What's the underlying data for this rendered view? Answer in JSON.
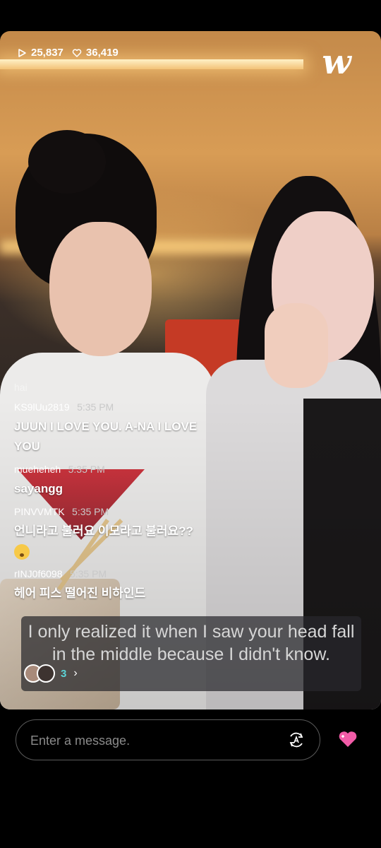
{
  "stats": {
    "plays": "25,837",
    "likes": "36,419"
  },
  "brand": {
    "logo_text": "w"
  },
  "chat": [
    {
      "user": "hai",
      "time": "",
      "text": "",
      "faded": true
    },
    {
      "user": "KS9lUu2819",
      "time": "5:35 PM",
      "text": "JUUN I LOVE YOU. A-NA I LOVE YOU"
    },
    {
      "user": "mueheheh",
      "time": "5:35 PM",
      "text": "sayangg"
    },
    {
      "user": "PINVVMTK",
      "time": "5:35 PM",
      "text": "언니라고 불러요 이모라고 불러요??"
    },
    {
      "user": "rINJ0f6098",
      "time": "5:35 PM",
      "text": "헤어 피스 떨어진 비하인드"
    }
  ],
  "caption": {
    "text": "I only realized it when I saw your head fall in the middle because I didn't know."
  },
  "viewers": {
    "count": "3"
  },
  "input": {
    "placeholder": "Enter a message."
  },
  "colors": {
    "accent": "#5cd3d6",
    "heart": "#f25ca8"
  },
  "icons": [
    "play-icon",
    "heart-outline-icon",
    "translate-icon",
    "heart-filled-icon",
    "chevron-right-icon"
  ]
}
